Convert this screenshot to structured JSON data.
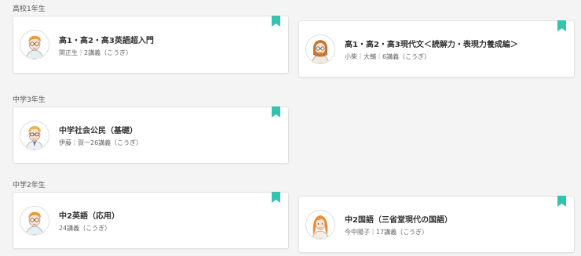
{
  "sections": [
    {
      "label": "高校1年生"
    },
    {
      "label": "中学3年生"
    },
    {
      "label": "中学2年生"
    }
  ],
  "cards": [
    {
      "title": "高1・高2・高3英語超入門",
      "subtitle": "関正生｜2講義（こうぎ）",
      "teacher_icon": "male-teacher-avatar-glasses-orange-hair"
    },
    {
      "title": "高1・高2・高3現代文＜読解力・表現力養成編＞",
      "subtitle": "小柴｜大輔｜6講義（こうぎ）",
      "teacher_icon": "male-teacher-avatar-glasses-beard"
    },
    {
      "title": "中学社会公民（基礎）",
      "subtitle": "伊藤｜賀一26講義（こうぎ）",
      "teacher_icon": "male-teacher-avatar-glasses-blond"
    },
    {
      "title": "中2英語（応用）",
      "subtitle": "24講義（こうぎ）",
      "teacher_icon": "male-teacher-avatar-glasses-orange-hair"
    },
    {
      "title": "中2国語（三省堂現代の国語）",
      "subtitle": "今中陽子｜17講義（こうぎ）",
      "teacher_icon": "female-teacher-avatar-long-hair"
    }
  ],
  "colors": {
    "bookmark": "#35c2b0",
    "background": "#f4f4f4",
    "card": "#ffffff"
  }
}
